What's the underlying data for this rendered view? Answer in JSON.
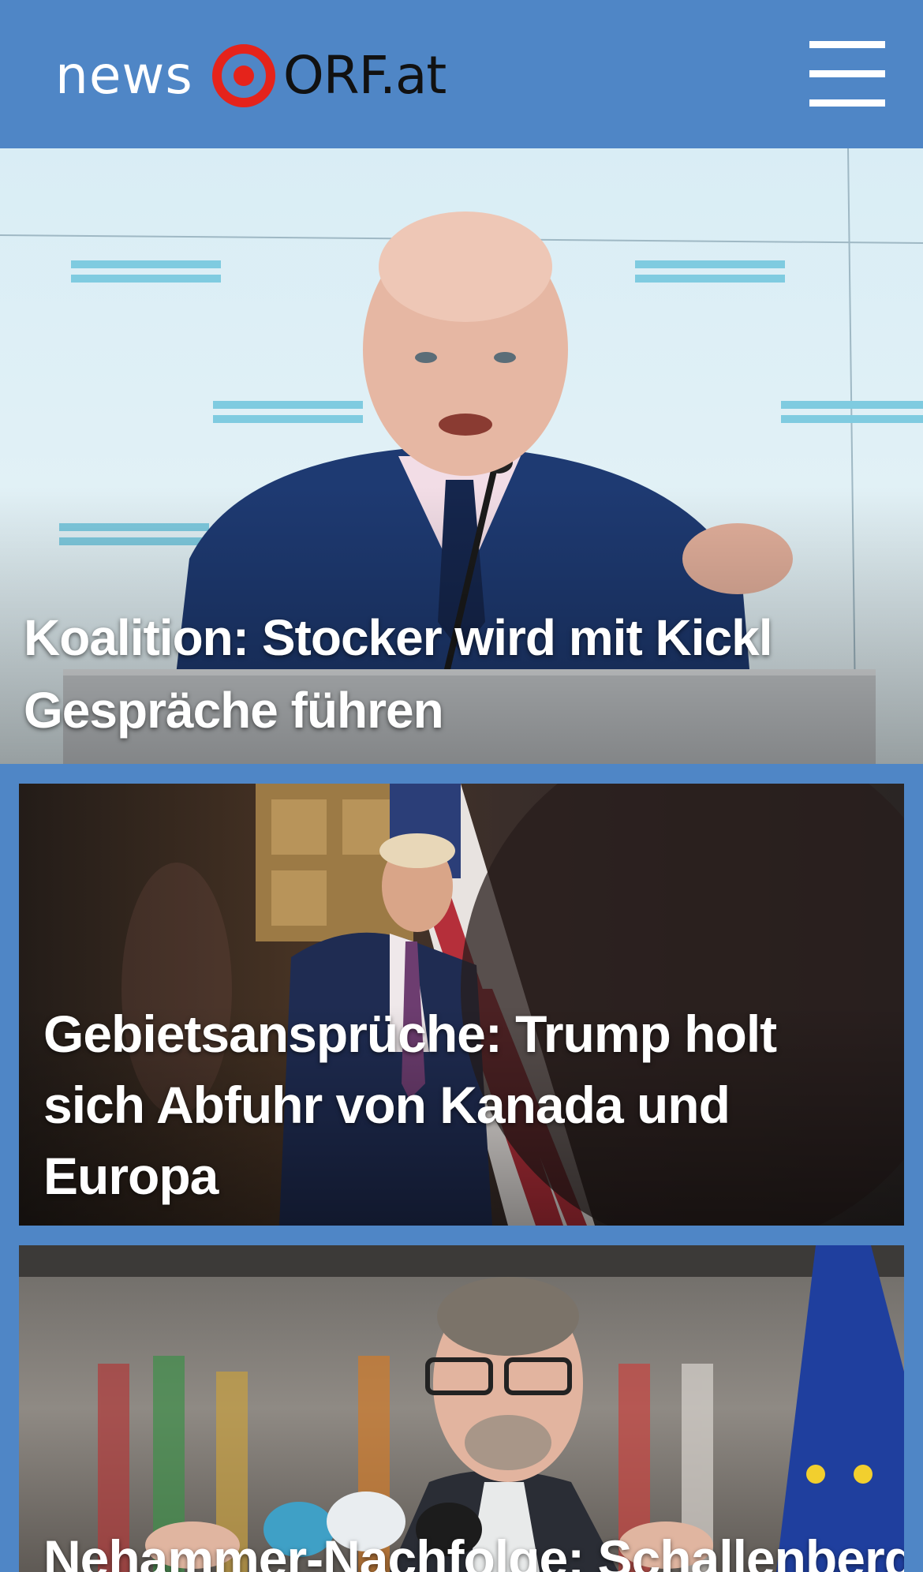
{
  "header": {
    "logo_news": "news",
    "logo_orf": "ORF.at",
    "background_color": "#4f86c6",
    "logo_mark_color": "#e5231b",
    "menu_icon": "hamburger-menu-icon"
  },
  "stories": [
    {
      "title": "Koalition: Stocker wird mit Kickl Gespräche führen"
    },
    {
      "title": "Gebietsansprüche: Trump holt sich Abfuhr von Kanada und Europa"
    },
    {
      "title": "Nehammer-Nachfolge: Schallenberg"
    }
  ]
}
